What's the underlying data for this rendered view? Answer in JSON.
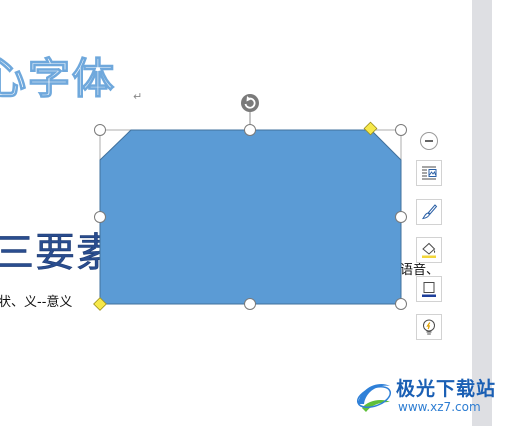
{
  "document": {
    "title_fragment": "心字体",
    "paragraph_mark": "↵",
    "heading_fragment": "三要素",
    "body_line_fragment": "状、义--意义",
    "body_right_fragment": "语音、"
  },
  "shape": {
    "type": "snip-corner-rectangle",
    "fill_color": "#5b9bd5",
    "outline_color": "#41719c"
  },
  "shape_toolbar": {
    "collapse": "collapse-toggle",
    "tools": [
      {
        "name": "layout-options",
        "icon": "text-wrap-icon"
      },
      {
        "name": "shape-style",
        "icon": "brush-icon"
      },
      {
        "name": "shape-fill",
        "icon": "fill-bucket-icon"
      },
      {
        "name": "shape-outline",
        "icon": "outline-icon"
      },
      {
        "name": "smart-tips",
        "icon": "lightbulb-icon"
      }
    ]
  },
  "watermark": {
    "name": "极光下载站",
    "url": "www.xz7.com"
  }
}
